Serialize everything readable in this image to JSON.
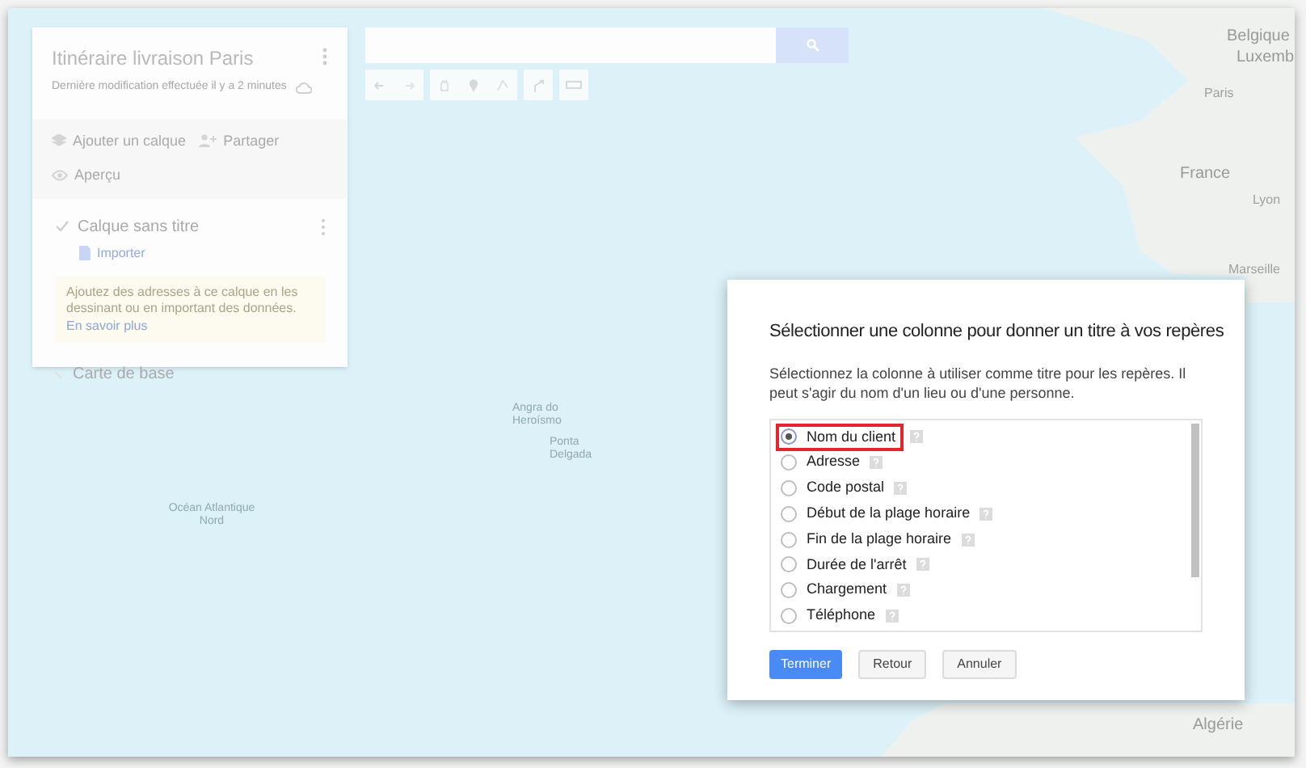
{
  "map": {
    "labels": [
      {
        "text": "Belgique",
        "kind": "country"
      },
      {
        "text": "Luxemb",
        "kind": "country"
      },
      {
        "text": "Paris",
        "kind": "city"
      },
      {
        "text": "France",
        "kind": "country"
      },
      {
        "text": "Lyon",
        "kind": "city"
      },
      {
        "text": "Marseille",
        "kind": "city"
      },
      {
        "text": "Angra do Heroísmo",
        "kind": "small"
      },
      {
        "text": "Ponta Delgada",
        "kind": "small"
      },
      {
        "text": "Océan Atlantique Nord",
        "kind": "water"
      },
      {
        "text": "Algérie",
        "kind": "country"
      }
    ]
  },
  "panel": {
    "title": "Itinéraire livraison Paris",
    "subtitle": "Dernière modification effectuée il y a 2 minutes",
    "actions": [
      {
        "label": "Ajouter un calque",
        "kind": "layer"
      },
      {
        "label": "Partager",
        "kind": "share"
      },
      {
        "label": "Aperçu",
        "kind": "preview"
      }
    ],
    "layer": {
      "name": "Calque sans titre",
      "checked": true,
      "import_link": "Importer",
      "hint": "Ajoutez des adresses à ce calque en les dessinant ou en important des données.",
      "hint_link": "En savoir plus"
    },
    "base_map": "Carte de base"
  },
  "dialog": {
    "title": "Sélectionner une colonne pour donner un titre à vos repères",
    "description": "Sélectionnez la colonne à utiliser comme titre pour les repères. Il peut s'agir du nom d'un lieu ou d'une personne.",
    "options": [
      {
        "label": "Nom du client",
        "selected": true
      },
      {
        "label": "Adresse",
        "selected": false
      },
      {
        "label": "Code postal",
        "selected": false
      },
      {
        "label": "Début de la plage horaire",
        "selected": false
      },
      {
        "label": "Fin de la plage horaire",
        "selected": false
      },
      {
        "label": "Durée de l'arrêt",
        "selected": false
      },
      {
        "label": "Chargement",
        "selected": false
      },
      {
        "label": "Téléphone",
        "selected": false
      }
    ],
    "buttons": [
      {
        "label": "Terminer",
        "kind": "primary"
      },
      {
        "label": "Retour",
        "kind": "secondary"
      },
      {
        "label": "Annuler",
        "kind": "secondary"
      }
    ]
  }
}
